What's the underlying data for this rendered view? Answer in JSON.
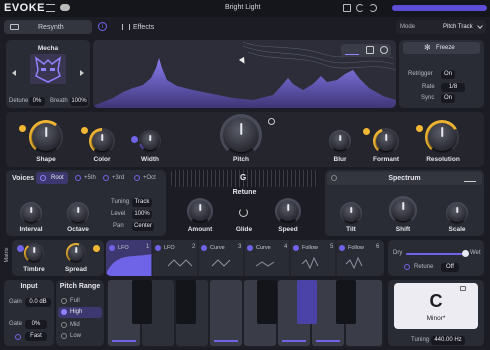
{
  "topbar": {
    "logo": "EVOKE",
    "preset": "Bright Light",
    "tab_resynth": "Resynth",
    "tab_effects": "Effects",
    "mode_label": "Mode",
    "mode_value": "Pitch Track"
  },
  "source": {
    "name": "Mecha",
    "detune_label": "Detune",
    "detune_value": "0%",
    "breath_label": "Breath",
    "breath_value": "100%"
  },
  "freeze": {
    "label": "Freeze",
    "retrigger_label": "Retrigger",
    "retrigger_value": "On",
    "rate_label": "Rate",
    "rate_value": "1/8",
    "sync_label": "Sync",
    "sync_value": "On"
  },
  "knobs_row1": {
    "shape": "Shape",
    "color": "Color",
    "width": "Width",
    "pitch": "Pitch",
    "blur": "Blur",
    "formant": "Formant",
    "resolution": "Resolution"
  },
  "voices": {
    "title": "Voices",
    "root": "Root",
    "fifth": "+5th",
    "third": "+3rd",
    "octave_btn": "+Oct",
    "interval": "Interval",
    "octave": "Octave",
    "tuning_label": "Tuning",
    "tuning_value": "Track",
    "level_label": "Level",
    "level_value": "100%",
    "pan_label": "Pan",
    "pan_value": "Center"
  },
  "retune": {
    "note": "G",
    "title": "Retune",
    "amount": "Amount",
    "glide": "Glide",
    "speed": "Speed"
  },
  "spectrum": {
    "title": "Spectrum",
    "tilt": "Tilt",
    "shift": "Shift",
    "scale": "Scale"
  },
  "matrix": {
    "label": "Matrix",
    "timbre": "Timbre",
    "spread": "Spread",
    "mod_tabs": [
      {
        "name": "LFO",
        "num": "1"
      },
      {
        "name": "LFO",
        "num": "2"
      },
      {
        "name": "Curve",
        "num": "3"
      },
      {
        "name": "Curve",
        "num": "4"
      },
      {
        "name": "Follow",
        "num": "5"
      },
      {
        "name": "Follow",
        "num": "6"
      }
    ]
  },
  "mix": {
    "dry": "Dry",
    "wet": "Wet",
    "retune_label": "Retune",
    "retune_value": "Off"
  },
  "input": {
    "title": "Input",
    "gain_label": "Gain",
    "gain_value": "0.0 dB",
    "gate_label": "Gate",
    "gate_value": "0%",
    "fast": "Fast"
  },
  "pitch_range": {
    "title": "Pitch Range",
    "options": [
      "Full",
      "High",
      "Mid",
      "Low"
    ],
    "selected": "High"
  },
  "key": {
    "note": "C",
    "scale": "Minor*",
    "tuning_label": "Tuning",
    "tuning_value": "440.00 Hz"
  },
  "colors": {
    "accent": "#6f63e8",
    "gold": "#f2b733",
    "panel": "#2a2c35",
    "bg": "#1c1d24"
  }
}
